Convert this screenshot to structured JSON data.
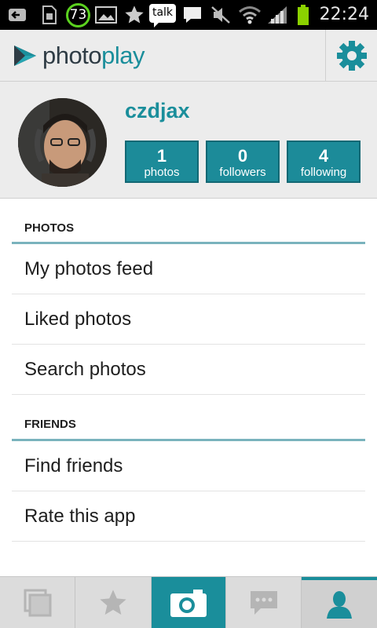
{
  "status_bar": {
    "battery_badge": "73",
    "talk_label": "talk",
    "time": "22:24"
  },
  "header": {
    "logo_photo": "photo",
    "logo_play": "play"
  },
  "profile": {
    "username": "czdjax",
    "stats": [
      {
        "num": "1",
        "label": "photos"
      },
      {
        "num": "0",
        "label": "followers"
      },
      {
        "num": "4",
        "label": "following"
      }
    ]
  },
  "menu": {
    "photos_header": "PHOTOS",
    "photos_items": [
      "My photos feed",
      "Liked photos",
      "Search photos"
    ],
    "friends_header": "FRIENDS",
    "friends_items": [
      "Find friends",
      "Rate this app"
    ]
  },
  "colors": {
    "accent": "#1a8e9b",
    "stat_bg": "#1c8b99"
  },
  "tabbar": {
    "tabs": [
      "gallery-icon",
      "star-icon",
      "camera-icon",
      "chat-icon",
      "person-icon"
    ],
    "active_tab": "person-icon"
  }
}
